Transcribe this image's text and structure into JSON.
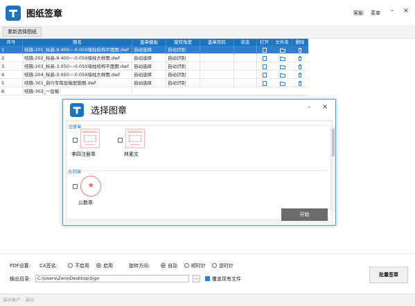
{
  "app": {
    "title": "图纸签章",
    "help_label": "客服",
    "menu_label": "菜单",
    "brand_color": "#1c74bd"
  },
  "toolbar": {
    "reselect_label": "重新选择图纸"
  },
  "table": {
    "columns": [
      "序号",
      "图名",
      "盖章模板",
      "旋转角度",
      "盖章页码",
      "状态",
      "打开",
      "文件夹",
      "删除"
    ],
    "rows": [
      {
        "index": "1",
        "name": "结施-201_标高-9.400~-0.050墙柱结构平面图.dwf",
        "template": "自动选择",
        "rotation": "自动识别",
        "page": "",
        "status": ""
      },
      {
        "index": "2",
        "name": "结施-202_标高-9.400~-0.050墙柱大样图.dwf",
        "template": "自动选择",
        "rotation": "自动识别",
        "page": "",
        "status": ""
      },
      {
        "index": "3",
        "name": "结施-203_标高-3.050~-0.050墙柱结构平面图.dwf",
        "template": "自动选择",
        "rotation": "自动识别",
        "page": "",
        "status": ""
      },
      {
        "index": "4",
        "name": "结施-204_标高-3.050~-0.050墙柱大样图.dwf",
        "template": "自动选择",
        "rotation": "自动识别",
        "page": "",
        "status": ""
      },
      {
        "index": "5",
        "name": "结施-301_自行车库层板配筋图.dwf",
        "template": "自动选择",
        "rotation": "自动识别",
        "page": "",
        "status": ""
      },
      {
        "index": "6",
        "name": "结施-303_一层板",
        "template": "",
        "rotation": "",
        "page": "",
        "status": ""
      }
    ],
    "selected_row": 1
  },
  "modal": {
    "title": "选择图章",
    "sections": [
      {
        "label": "注册章",
        "seals": [
          {
            "name": "李四注册章"
          },
          {
            "name": "林素文"
          }
        ]
      },
      {
        "label": "合同章",
        "seals": [
          {
            "name": "公数章"
          }
        ]
      }
    ],
    "start_label": "开始"
  },
  "settings": {
    "pdf_label": "PDF设置:",
    "ca_label": "CA签名:",
    "ca_options": [
      "不启用",
      "启用"
    ],
    "ca_selected": "启用",
    "rotate_label": "旋转方向:",
    "rotate_options": [
      "自动",
      "顺时针",
      "逆时针"
    ],
    "rotate_selected": "自动",
    "output_label": "输出目录:",
    "output_path": "C:\\Users\\Zero\\Desktop\\Sign",
    "browse_label": "...",
    "overwrite_label": "覆盖现有文件",
    "overwrite_checked": true,
    "big_button_label": "批量签章"
  },
  "status": {
    "text": "演示账户 - 演示"
  }
}
